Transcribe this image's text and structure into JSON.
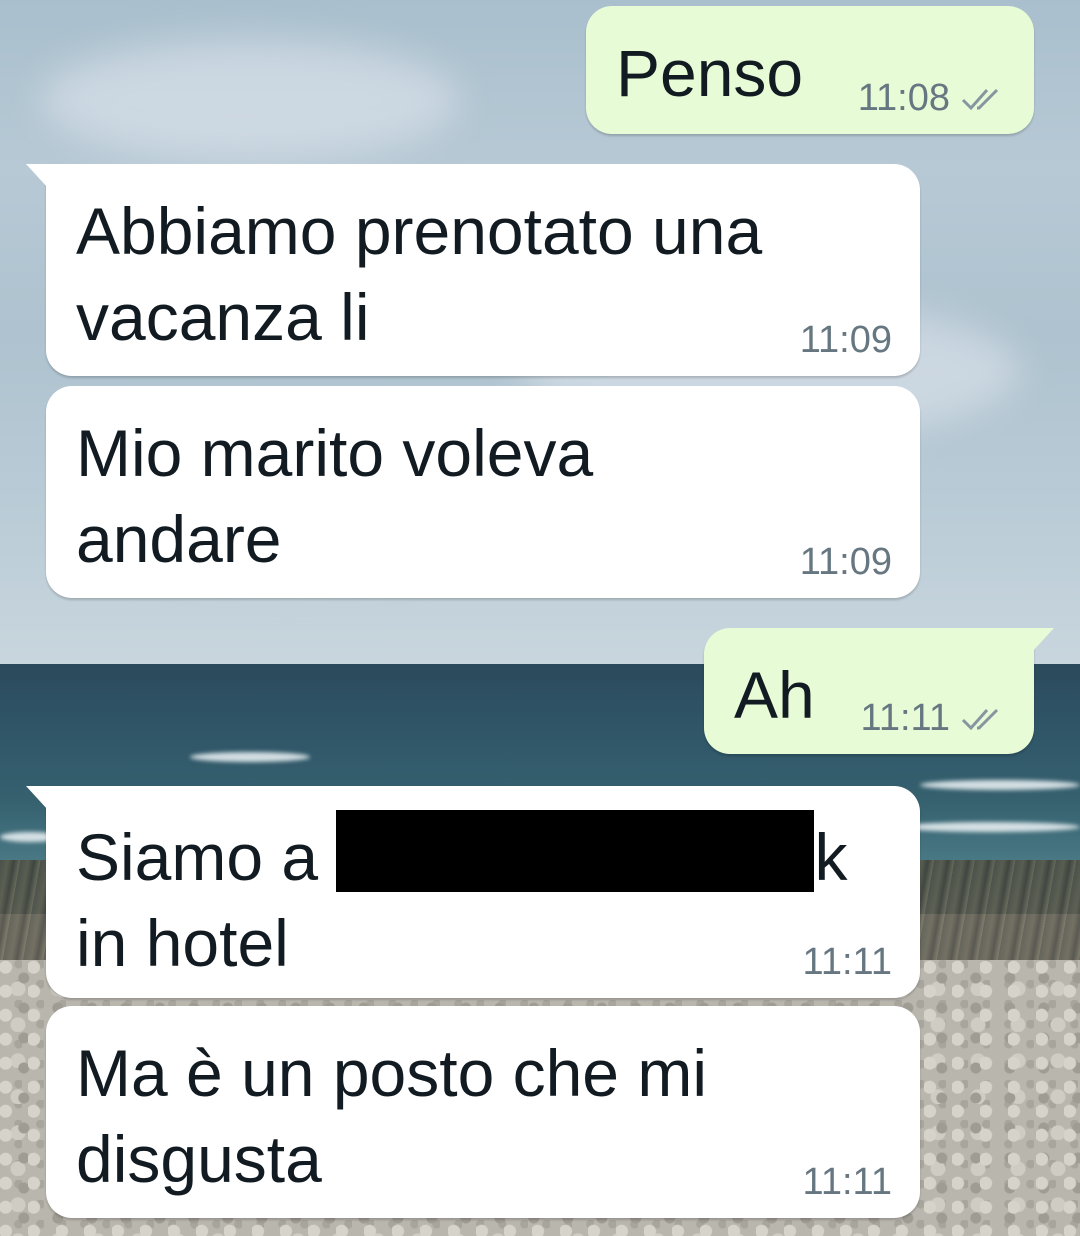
{
  "messages": [
    {
      "direction": "outgoing",
      "text": "Penso",
      "time": "11:08",
      "status_icon": "double-check-icon"
    },
    {
      "direction": "incoming",
      "text": "Abbiamo prenotato una\nvacanza li",
      "time": "11:09"
    },
    {
      "direction": "incoming",
      "text": "Mio marito voleva\nandare",
      "time": "11:09"
    },
    {
      "direction": "outgoing",
      "text": "Ah",
      "time": "11:11",
      "status_icon": "double-check-icon"
    },
    {
      "direction": "incoming",
      "text_before": "Siamo a ",
      "text_redacted": true,
      "text_after": "k",
      "text_line2": "in hotel",
      "time": "11:11"
    },
    {
      "direction": "incoming",
      "text": "Ma è un posto che mi\ndisgusta",
      "time": "11:11"
    }
  ],
  "colors": {
    "incoming_bubble": "#ffffff",
    "outgoing_bubble": "#e8fbd7",
    "timestamp": "#667781",
    "text": "#111b21"
  }
}
